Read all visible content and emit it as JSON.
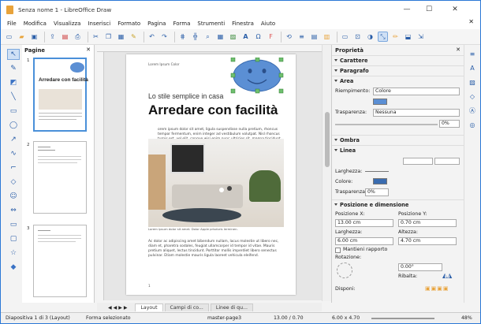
{
  "window": {
    "title": "Senza nome 1 - LibreOffice Draw"
  },
  "menu": [
    "File",
    "Modifica",
    "Visualizza",
    "Inserisci",
    "Formato",
    "Pagina",
    "Forma",
    "Strumenti",
    "Finestra",
    "Aiuto"
  ],
  "pages_panel": {
    "title": "Pagine",
    "page_numbers": [
      "1",
      "2",
      "3"
    ],
    "thumb1_title": "Arredare con facilità"
  },
  "document": {
    "header_small": "Lorem Ipsum Color",
    "subtitle": "Lo stile semplice in casa",
    "title": "Arredare con facilità",
    "para1": "orem ipsum dolor sit amet, ligula suspendisse nulla pretium, rhoncus tempor fermentum, enim integer ad vestibulum volutpat. Nisl rhoncus turpis est, vel elit, congue wisi enim nunc ultricies sit, magna tincidunt.",
    "caption": "Lorem ipsum dolor sit amet. Dolor Apple prisduris lerminen.",
    "para2": "Ac dolor ac adipiscing amet bibendum nullam, lacus molestie ut libero nec, diam et, pharetra sodales, feugiat ullamcorper id tempor id vitae. Mauris pretium aliquet, lectus tincidunt. Porttitor mollis imperdiet libero senectus pulvinar. Etiam molestie mauris ligula laoreet vehicula eleifend.",
    "page_number": "1"
  },
  "properties": {
    "title": "Proprietà",
    "sections": {
      "char": "Carattere",
      "para": "Paragrafo",
      "area": "Area",
      "shadow": "Ombra",
      "line": "Linea",
      "pos": "Posizione e dimensione"
    },
    "fill_label": "Riempimento:",
    "fill_value": "Colore",
    "transparency_label": "Trasparenza:",
    "transparency_value": "Nessuna",
    "transparency_pct": "0%",
    "line_width_label": "Larghezza:",
    "line_color_label": "Colore:",
    "line_transp_label": "Trasparenza:",
    "line_transp_value": "0%",
    "pos_x_label": "Posizione X:",
    "pos_x": "13.00 cm",
    "pos_y_label": "Posizione Y:",
    "pos_y": "0.70 cm",
    "width_label": "Larghezza:",
    "width": "6.00 cm",
    "height_label": "Altezza:",
    "height": "4.70 cm",
    "keep_ratio": "Mantieni rapporto",
    "rotation_label": "Rotazione:",
    "rotation": "0.00°",
    "flip_label": "Ribalta:",
    "arrange_label": "Disponi:"
  },
  "tabs": [
    "Layout",
    "Campi di co...",
    "Linee di qu..."
  ],
  "status": {
    "slide": "Diapositiva 1 di 3 (Layout)",
    "selection": "Forma selezionato",
    "master": "master-page3",
    "pos": "13.00 / 0.70",
    "size": "6.00 x 4.70",
    "zoom": "48%"
  },
  "colors": {
    "accent": "#4a90d9",
    "shape_fill": "#5b8fd4"
  }
}
